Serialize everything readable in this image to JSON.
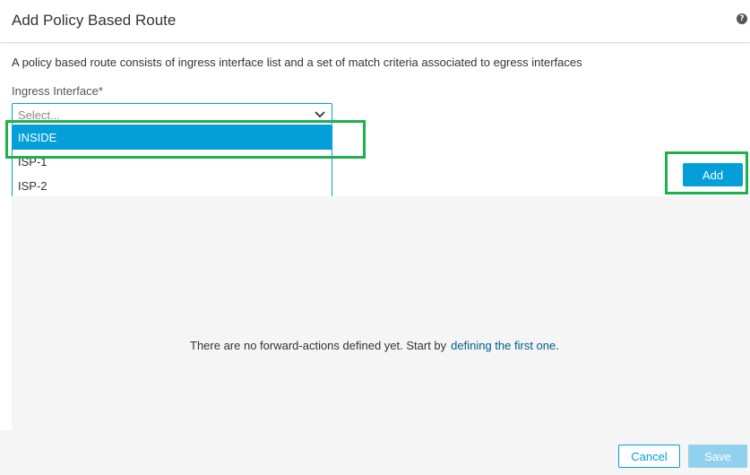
{
  "dialog": {
    "title": "Add Policy Based Route",
    "help_icon": "question-circle-icon",
    "description": "A policy based route consists of ingress interface list and a set of match criteria associated to egress interfaces"
  },
  "ingress": {
    "label": "Ingress Interface*",
    "placeholder": "Select...",
    "chevron_icon": "chevron-down-icon",
    "options": [
      "INSIDE",
      "ISP-1",
      "ISP-2"
    ],
    "highlighted_option": "INSIDE"
  },
  "actions": {
    "add_label": "Add"
  },
  "empty_state": {
    "text": "There are no forward-actions defined yet. Start by",
    "link_text": "defining the first one",
    "suffix": "."
  },
  "footer": {
    "cancel_label": "Cancel",
    "save_label": "Save"
  },
  "colors": {
    "accent": "#049fd9",
    "accent_disabled": "#92d1ed",
    "annotation_highlight": "#1db04b",
    "panel_bg": "#f5f5f5",
    "link": "#005c8a"
  }
}
